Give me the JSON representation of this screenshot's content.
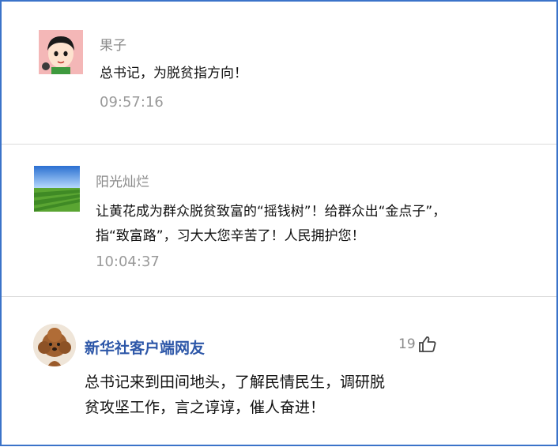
{
  "comments": [
    {
      "username": "果子",
      "avatar": "cartoon-boy-avatar",
      "lines": [
        "总书记，为脱贫指方向！"
      ],
      "time": "09:57:16"
    },
    {
      "username": "阳光灿烂",
      "avatar": "green-field-avatar",
      "lines": [
        "让黄花成为群众脱贫致富的“摇钱树”！给群众出“金点子”，",
        "指“致富路”，习大大您辛苦了！人民拥护您！"
      ],
      "time": "10:04:37"
    },
    {
      "username": "新华社客户端网友",
      "avatar": "poodle-dog-avatar",
      "likes": "19",
      "lines": [
        "总书记来到田间地头，了解民情民生，调研脱",
        "贫攻坚工作，言之谆谆，催人奋进！"
      ]
    }
  ],
  "colors": {
    "frame_border": "#3b73c9",
    "username_link": "#2d57a8",
    "muted_text": "#8a8a8a"
  }
}
